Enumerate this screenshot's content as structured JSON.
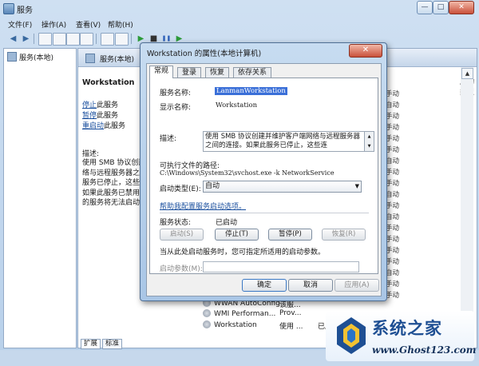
{
  "window": {
    "title": "服务",
    "min": "—",
    "max": "□",
    "close": "✕"
  },
  "menu": [
    "文件(F)",
    "操作(A)",
    "查看(V)",
    "帮助(H)"
  ],
  "toolbar": {
    "back": "◀",
    "forward": "▶",
    "play": "▶",
    "stop": "■",
    "pause": "❚❚",
    "restart": "▶"
  },
  "tree": {
    "root": "服务(本地)"
  },
  "content": {
    "header": "服务(本地)",
    "service_title": "Workstation",
    "links": [
      {
        "underline": "停止",
        "rest": "此服务"
      },
      {
        "underline": "暂停",
        "rest": "此服务"
      },
      {
        "underline": "重启动",
        "rest": "此服务"
      }
    ],
    "desc_label": "描述:",
    "desc_lines": [
      "使用 SMB 协议创建",
      "络与远程服务器之",
      "服务已停止，这些",
      "如果此服务已禁用",
      "的服务将无法启动"
    ],
    "column_header": "启动类型",
    "startup_types": [
      "手动",
      "自动",
      "手动",
      "手动",
      "手动",
      "手动",
      "自动",
      "手动",
      "手动",
      "自动",
      "手动",
      "自动",
      "手动",
      "手动",
      "手动",
      "手动",
      "自动",
      "手动",
      "手动"
    ],
    "rows": [
      {
        "name": "WMI Performan...",
        "desc": "Prov...",
        "status": ""
      },
      {
        "name": "Workstation",
        "desc": "使用 ...",
        "status": "已启动"
      },
      {
        "name": "WWAN AutoConfig",
        "desc": "该服...",
        "status": ""
      }
    ],
    "bottom_tabs": [
      "扩展",
      "标准"
    ]
  },
  "dialog": {
    "title": "Workstation 的属性(本地计算机)",
    "close": "✕",
    "tabs": [
      "常规",
      "登录",
      "恢复",
      "依存关系"
    ],
    "service_name_label": "服务名称:",
    "service_name": "LanmanWorkstation",
    "display_name_label": "显示名称:",
    "display_name": "Workstation",
    "description_label": "描述:",
    "description": "使用 SMB 协议创建并维护客户端网络与远程服务器之间的连接。如果此服务已停止，这些连",
    "path_label": "可执行文件的路径:",
    "path": "C:\\Windows\\System32\\svchost.exe -k NetworkService",
    "startup_label": "启动类型(E):",
    "startup_value": "自动",
    "help_link": "帮助我配置服务启动选项。",
    "status_label": "服务状态:",
    "status_value": "已启动",
    "control_buttons": [
      "启动(S)",
      "停止(T)",
      "暂停(P)",
      "恢复(R)"
    ],
    "params_note": "当从此处启动服务时，您可指定所适用的启动参数。",
    "params_label": "启动参数(M):",
    "params_value": "",
    "ok": "确定",
    "cancel": "取消",
    "apply": "应用(A)"
  },
  "watermark": {
    "text": "系统之家",
    "url": "www.Ghost123.com"
  },
  "colors": {
    "accent": "#3a6fd8",
    "link": "#1a4f9e",
    "frame": "#b9d1ea"
  }
}
